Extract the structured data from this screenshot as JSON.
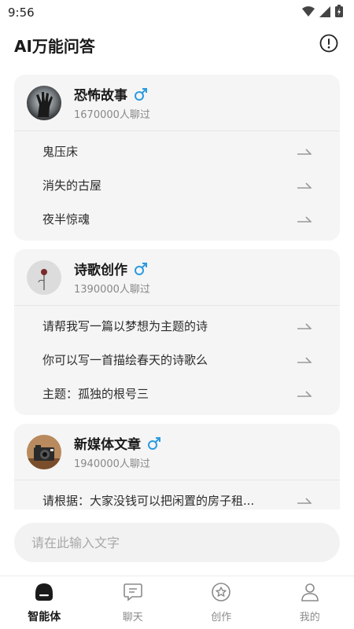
{
  "status": {
    "time": "9:56"
  },
  "header": {
    "title": "AI万能问答"
  },
  "icons": {
    "wifi": "wifi-icon",
    "signal": "signal-icon",
    "battery": "battery-icon",
    "info": "info-icon",
    "male": "male-icon",
    "arrow": "arrow-right-icon"
  },
  "colors": {
    "accent": "#2a9be0",
    "icon_gray": "#9a9a9a"
  },
  "cards": [
    {
      "title": "恐怖故事",
      "subtitle": "1670000人聊过",
      "suggestions": [
        "鬼压床",
        "消失的古屋",
        "夜半惊魂"
      ]
    },
    {
      "title": "诗歌创作",
      "subtitle": "1390000人聊过",
      "suggestions": [
        "请帮我写一篇以梦想为主题的诗",
        "你可以写一首描绘春天的诗歌么",
        "主题：孤独的根号三"
      ]
    },
    {
      "title": "新媒体文章",
      "subtitle": "1940000人聊过",
      "suggestions": [
        "请根据：大家没钱可以把闲置的房子租..."
      ]
    }
  ],
  "input": {
    "placeholder": "请在此输入文字"
  },
  "tabs": [
    {
      "label": "智能体",
      "icon": "agent-icon",
      "active": true
    },
    {
      "label": "聊天",
      "icon": "chat-icon",
      "active": false
    },
    {
      "label": "创作",
      "icon": "create-icon",
      "active": false
    },
    {
      "label": "我的",
      "icon": "profile-icon",
      "active": false
    }
  ]
}
